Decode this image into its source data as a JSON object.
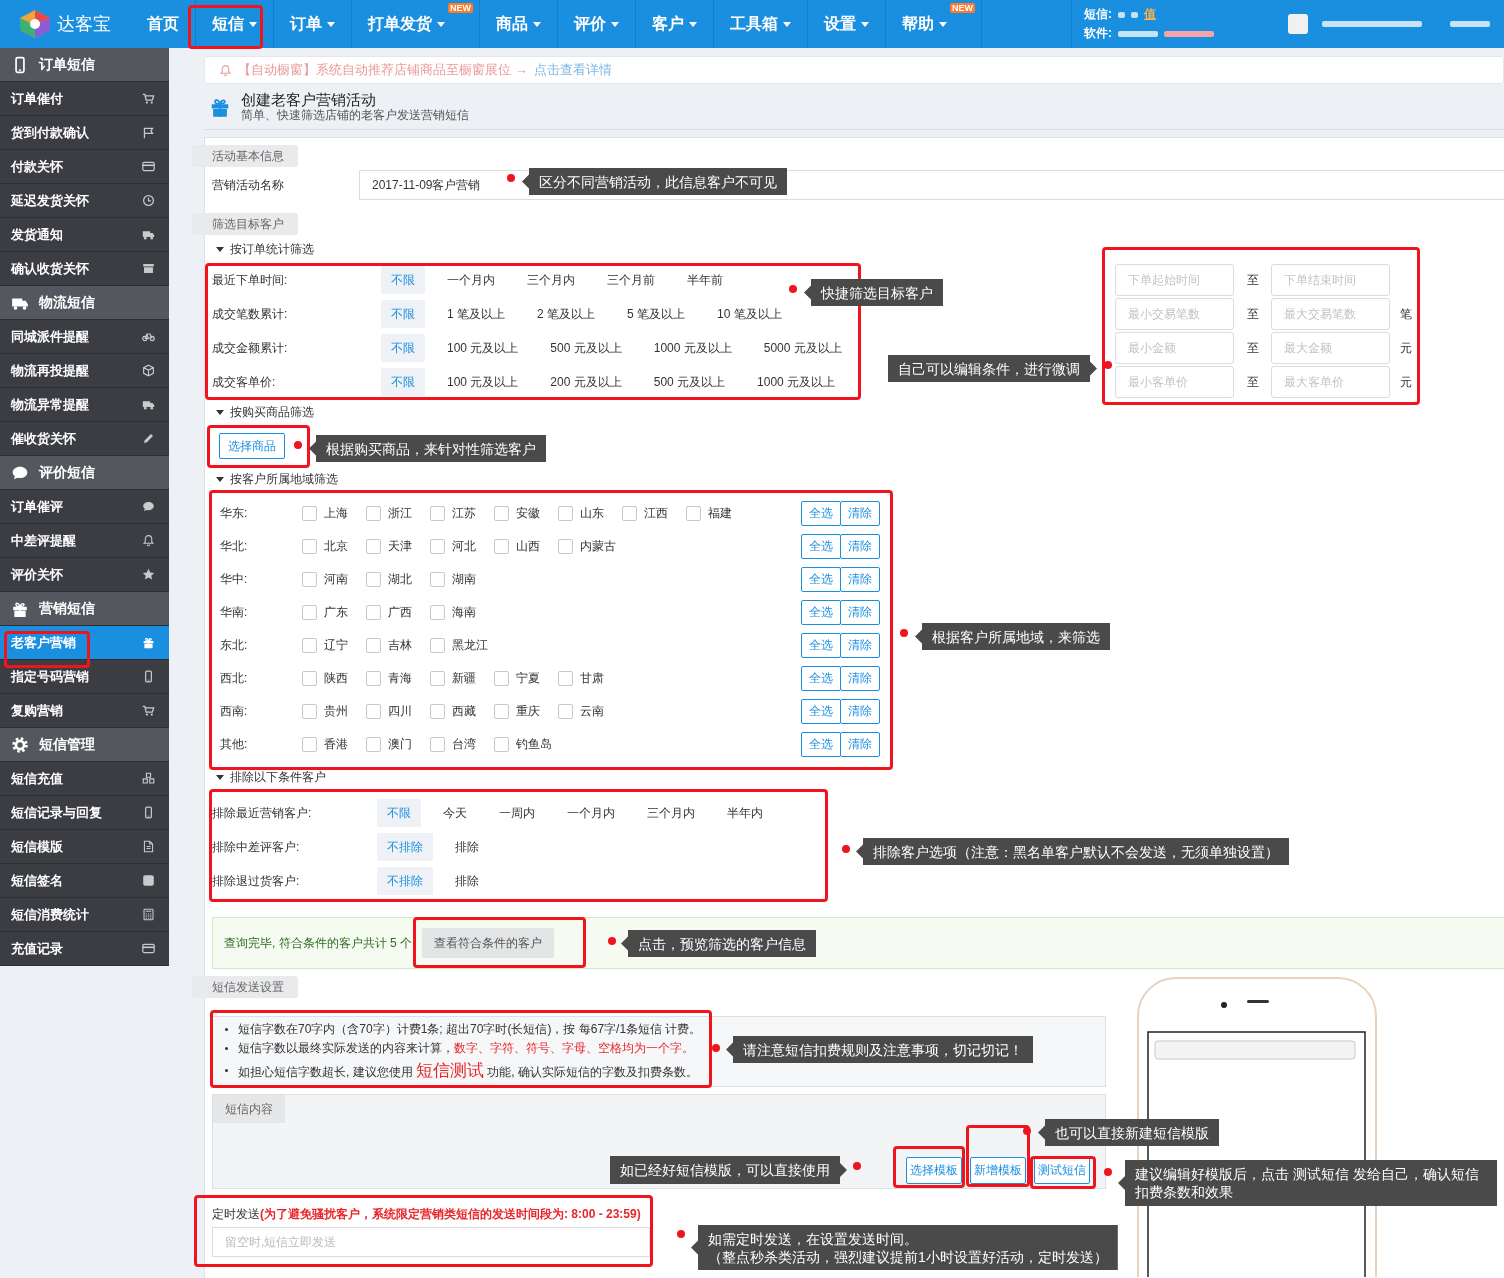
{
  "header": {
    "logo": "达客宝",
    "nav": [
      {
        "label": "首页",
        "caret": false
      },
      {
        "label": "短信",
        "caret": true
      },
      {
        "label": "订单",
        "caret": true
      },
      {
        "label": "打单发货",
        "caret": true,
        "badge": "NEW"
      },
      {
        "label": "商品",
        "caret": true
      },
      {
        "label": "评价",
        "caret": true
      },
      {
        "label": "客户",
        "caret": true
      },
      {
        "label": "工具箱",
        "caret": true
      },
      {
        "label": "设置",
        "caret": true
      },
      {
        "label": "帮助",
        "caret": true,
        "badge": "NEW"
      }
    ],
    "account": {
      "sms_label": "短信:",
      "recharge_link": "值",
      "software_label": "软件:"
    }
  },
  "sidebar": [
    {
      "title": "订单短信",
      "items": [
        {
          "label": "订单催付",
          "selected": false
        },
        {
          "label": "货到付款确认",
          "selected": false
        },
        {
          "label": "付款关怀",
          "selected": false
        },
        {
          "label": "延迟发货关怀",
          "selected": false
        },
        {
          "label": "发货通知",
          "selected": false
        },
        {
          "label": "确认收货关怀",
          "selected": false
        }
      ]
    },
    {
      "title": "物流短信",
      "items": [
        {
          "label": "同城派件提醒",
          "selected": false
        },
        {
          "label": "物流再投提醒",
          "selected": false
        },
        {
          "label": "物流异常提醒",
          "selected": false
        },
        {
          "label": "催收货关怀",
          "selected": false
        }
      ]
    },
    {
      "title": "评价短信",
      "items": [
        {
          "label": "订单催评",
          "selected": false
        },
        {
          "label": "中差评提醒",
          "selected": false
        },
        {
          "label": "评价关怀",
          "selected": false
        }
      ]
    },
    {
      "title": "营销短信",
      "items": [
        {
          "label": "老客户营销",
          "selected": true
        },
        {
          "label": "指定号码营销",
          "selected": false
        },
        {
          "label": "复购营销",
          "selected": false
        }
      ]
    },
    {
      "title": "短信管理",
      "items": [
        {
          "label": "短信充值",
          "selected": false
        },
        {
          "label": "短信记录与回复",
          "selected": false
        },
        {
          "label": "短信模版",
          "selected": false
        },
        {
          "label": "短信签名",
          "selected": false
        },
        {
          "label": "短信消费统计",
          "selected": false
        },
        {
          "label": "充值记录",
          "selected": false
        }
      ]
    }
  ],
  "notice": {
    "text": "【自动橱窗】系统自动推荐店铺商品至橱窗展位 →",
    "link": "点击查看详情"
  },
  "page_header": {
    "title": "创建老客户营销活动",
    "subtitle": "简单、快速筛选店铺的老客户发送营销短信"
  },
  "basic_info": {
    "tab": "活动基本信息",
    "name_label": "营销活动名称",
    "name_value": "2017-11-09客户营销"
  },
  "target": {
    "tab": "筛选目标客户",
    "order_stats": {
      "heading": "按订单统计筛选",
      "rows": [
        {
          "label": "最近下单时间:",
          "options": [
            {
              "label": "不限",
              "selected": true
            },
            {
              "label": "一个月内",
              "selected": false
            },
            {
              "label": "三个月内",
              "selected": false
            },
            {
              "label": "三个月前",
              "selected": false
            },
            {
              "label": "半年前",
              "selected": false
            }
          ]
        },
        {
          "label": "成交笔数累计:",
          "options": [
            {
              "label": "不限",
              "selected": true
            },
            {
              "label": "1 笔及以上",
              "selected": false
            },
            {
              "label": "2 笔及以上",
              "selected": false
            },
            {
              "label": "5 笔及以上",
              "selected": false
            },
            {
              "label": "10 笔及以上",
              "selected": false
            }
          ]
        },
        {
          "label": "成交金额累计:",
          "options": [
            {
              "label": "不限",
              "selected": true
            },
            {
              "label": "100 元及以上",
              "selected": false
            },
            {
              "label": "500 元及以上",
              "selected": false
            },
            {
              "label": "1000 元及以上",
              "selected": false
            },
            {
              "label": "5000 元及以上",
              "selected": false
            }
          ]
        },
        {
          "label": "成交客单价:",
          "options": [
            {
              "label": "不限",
              "selected": true
            },
            {
              "label": "100 元及以上",
              "selected": false
            },
            {
              "label": "200 元及以上",
              "selected": false
            },
            {
              "label": "500 元及以上",
              "selected": false
            },
            {
              "label": "1000 元及以上",
              "selected": false
            }
          ]
        }
      ],
      "custom_ranges": [
        {
          "from_placeholder": "下单起始时间",
          "separator": "至",
          "to_placeholder": "下单结束时间"
        },
        {
          "from_placeholder": "最小交易笔数",
          "separator": "至",
          "to_placeholder": "最大交易笔数",
          "unit": "笔"
        },
        {
          "from_placeholder": "最小金额",
          "separator": "至",
          "to_placeholder": "最大金额",
          "unit": "元"
        },
        {
          "from_placeholder": "最小客单价",
          "separator": "至",
          "to_placeholder": "最大客单价",
          "unit": "元"
        }
      ]
    },
    "products": {
      "heading": "按购买商品筛选",
      "button": "选择商品"
    },
    "regions": {
      "heading": "按客户所属地域筛选",
      "rows": [
        {
          "label": "华东:",
          "provinces": [
            {
              "name": "上海",
              "checked": false
            },
            {
              "name": "浙江",
              "checked": false
            },
            {
              "name": "江苏",
              "checked": false
            },
            {
              "name": "安徽",
              "checked": false
            },
            {
              "name": "山东",
              "checked": false
            },
            {
              "name": "江西",
              "checked": false
            },
            {
              "name": "福建",
              "checked": false
            }
          ],
          "select_all": "全选",
          "clear": "清除"
        },
        {
          "label": "华北:",
          "provinces": [
            {
              "name": "北京",
              "checked": false
            },
            {
              "name": "天津",
              "checked": false
            },
            {
              "name": "河北",
              "checked": false
            },
            {
              "name": "山西",
              "checked": false
            },
            {
              "name": "内蒙古",
              "checked": false
            }
          ],
          "select_all": "全选",
          "clear": "清除"
        },
        {
          "label": "华中:",
          "provinces": [
            {
              "name": "河南",
              "checked": false
            },
            {
              "name": "湖北",
              "checked": false
            },
            {
              "name": "湖南",
              "checked": false
            }
          ],
          "select_all": "全选",
          "clear": "清除"
        },
        {
          "label": "华南:",
          "provinces": [
            {
              "name": "广东",
              "checked": false
            },
            {
              "name": "广西",
              "checked": false
            },
            {
              "name": "海南",
              "checked": false
            }
          ],
          "select_all": "全选",
          "clear": "清除"
        },
        {
          "label": "东北:",
          "provinces": [
            {
              "name": "辽宁",
              "checked": false
            },
            {
              "name": "吉林",
              "checked": false
            },
            {
              "name": "黑龙江",
              "checked": false
            }
          ],
          "select_all": "全选",
          "clear": "清除"
        },
        {
          "label": "西北:",
          "provinces": [
            {
              "name": "陕西",
              "checked": false
            },
            {
              "name": "青海",
              "checked": false
            },
            {
              "name": "新疆",
              "checked": false
            },
            {
              "name": "宁夏",
              "checked": false
            },
            {
              "name": "甘肃",
              "checked": false
            }
          ],
          "select_all": "全选",
          "clear": "清除"
        },
        {
          "label": "西南:",
          "provinces": [
            {
              "name": "贵州",
              "checked": false
            },
            {
              "name": "四川",
              "checked": false
            },
            {
              "name": "西藏",
              "checked": false
            },
            {
              "name": "重庆",
              "checked": false
            },
            {
              "name": "云南",
              "checked": false
            }
          ],
          "select_all": "全选",
          "clear": "清除"
        },
        {
          "label": "其他:",
          "provinces": [
            {
              "name": "香港",
              "checked": false
            },
            {
              "name": "澳门",
              "checked": false
            },
            {
              "name": "台湾",
              "checked": false
            },
            {
              "name": "钓鱼岛",
              "checked": false
            }
          ],
          "select_all": "全选",
          "clear": "清除"
        }
      ]
    },
    "exclude": {
      "heading": "排除以下条件客户",
      "rows": [
        {
          "label": "排除最近营销客户:",
          "options": [
            {
              "label": "不限",
              "selected": true
            },
            {
              "label": "今天",
              "selected": false
            },
            {
              "label": "一周内",
              "selected": false
            },
            {
              "label": "一个月内",
              "selected": false
            },
            {
              "label": "三个月内",
              "selected": false
            },
            {
              "label": "半年内",
              "selected": false
            }
          ]
        },
        {
          "label": "排除中差评客户:",
          "options": [
            {
              "label": "不排除",
              "selected": true
            },
            {
              "label": "排除",
              "selected": false
            }
          ]
        },
        {
          "label": "排除退过货客户:",
          "options": [
            {
              "label": "不排除",
              "selected": true
            },
            {
              "label": "排除",
              "selected": false
            }
          ]
        }
      ]
    },
    "result": {
      "text": "查询完毕, 符合条件的客户共计 5 个",
      "button": "查看符合条件的客户"
    }
  },
  "sms": {
    "tab": "短信发送设置",
    "rules": [
      [
        {
          "kind": "plain",
          "text": "短信字数在70字内（含70字）计费1条; 超出70字时(长短信)，按 每67字/1条短信 计费。"
        }
      ],
      [
        {
          "kind": "plain",
          "text": "短信字数以最终实际发送的内容来计算，"
        },
        {
          "kind": "warning",
          "text": "数字、字符、符号、字母、空格均为一个字。"
        }
      ],
      [
        {
          "kind": "plain",
          "text": "如担心短信字数超长, 建议您使用 "
        },
        {
          "kind": "emphasis",
          "text": "短信测试"
        },
        {
          "kind": "plain",
          "text": " 功能, 确认实际短信的字数及扣费条数。"
        }
      ]
    ],
    "content_tab": "短信内容",
    "buttons": [
      "选择模板",
      "新增模板",
      "测试短信"
    ],
    "schedule": {
      "label": "定时发送",
      "warning": "(为了避免骚扰客户，系统限定营销类短信的发送时间段为: 8:00 - 23:59)",
      "placeholder": "留空时,短信立即发送"
    }
  },
  "annotations": [
    {
      "lines": [
        "区分不同营销活动，此信息客户不可见"
      ]
    },
    {
      "lines": [
        "快捷筛选目标客户"
      ]
    },
    {
      "lines": [
        "自己可以编辑条件，进行微调"
      ]
    },
    {
      "lines": [
        "根据购买商品，来针对性筛选客户"
      ]
    },
    {
      "lines": [
        "根据客户所属地域，来筛选"
      ]
    },
    {
      "lines": [
        "排除客户选项（注意：黑名单客户默认不会发送，无须单独设置）"
      ]
    },
    {
      "lines": [
        "点击，预览筛选的客户信息"
      ]
    },
    {
      "lines": [
        "请注意短信扣费规则及注意事项，切记切记！"
      ]
    },
    {
      "lines": [
        "也可以直接新建短信模版"
      ]
    },
    {
      "lines": [
        "如已经好短信模版，可以直接使用"
      ]
    },
    {
      "lines": [
        "建议编辑好模版后，点击 测试短信 发给自己，确认短信扣费条数和效果"
      ]
    },
    {
      "lines": [
        "如需定时发送，在设置发送时间。",
        "（整点秒杀类活动，强烈建议提前1小时设置好活动，定时发送）"
      ]
    }
  ]
}
